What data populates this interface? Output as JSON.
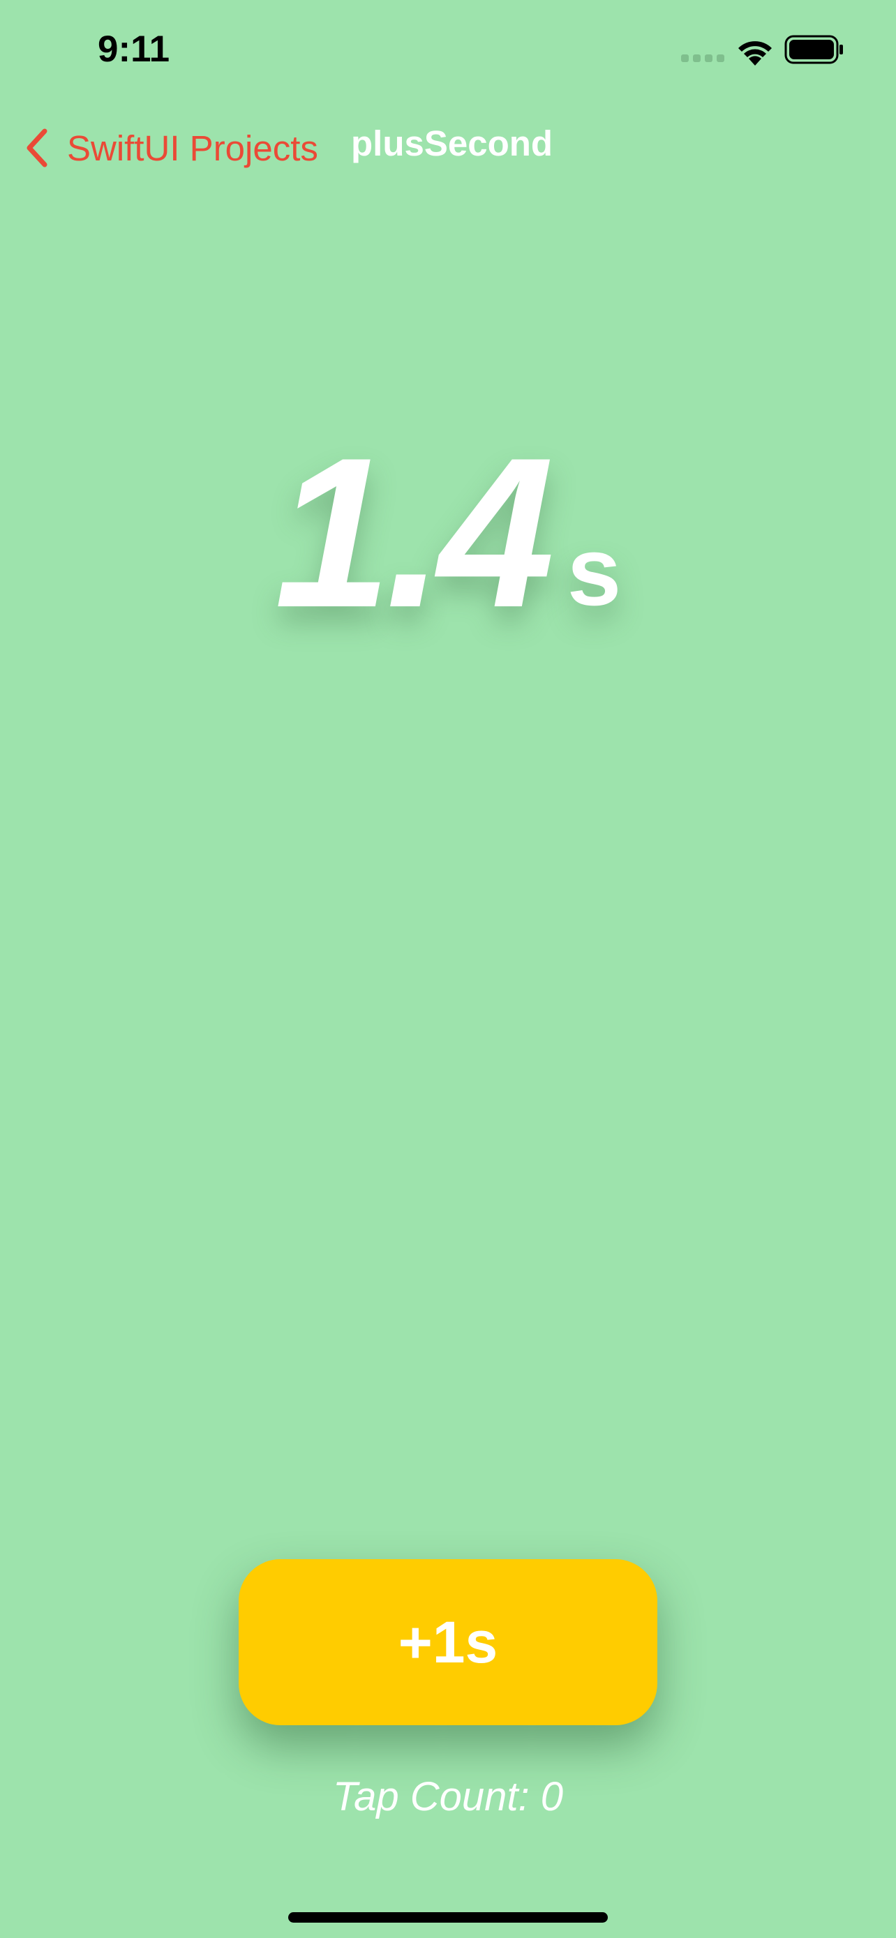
{
  "status_bar": {
    "time": "9:11",
    "icons": [
      "cellular-signal-icon",
      "wifi-icon",
      "battery-icon"
    ]
  },
  "nav": {
    "back_label": "SwiftUI Projects",
    "title": "plusSecond",
    "back_icon": "chevron-left-icon"
  },
  "timer": {
    "value": "1.4",
    "unit": "s"
  },
  "button": {
    "label": "+1s"
  },
  "tap_count": {
    "text": "Tap Count: 0"
  },
  "colors": {
    "background": "#9de3ac",
    "accent": "#ea4a36",
    "button": "#ffcc00",
    "text_light": "#ffffff"
  }
}
